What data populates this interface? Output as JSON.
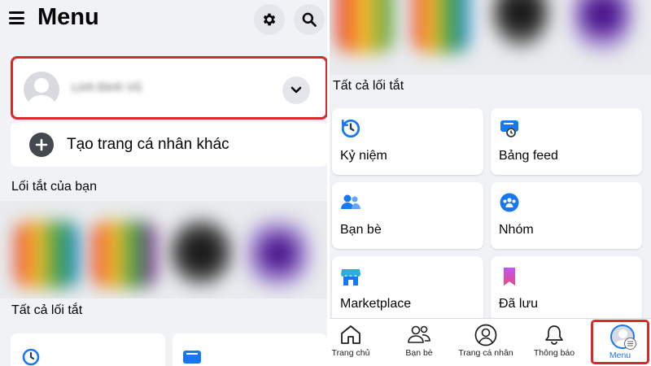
{
  "left": {
    "title": "Menu",
    "profile_name": "Linh Đinh Vũ",
    "create_profile_label": "Tạo trang cá nhân khác",
    "shortcuts_label": "Lối tắt của bạn",
    "all_shortcuts_label": "Tất cả lối tắt",
    "icons": {
      "menu": "hamburger-icon",
      "settings": "gear-icon",
      "search": "search-icon",
      "expand": "chevron-down-icon",
      "add": "plus-icon"
    }
  },
  "right": {
    "all_shortcuts_label": "Tất cả lối tắt",
    "shortcuts": [
      {
        "label": "Kỷ niệm",
        "icon": "memories-clock-icon",
        "color": "#1877f2"
      },
      {
        "label": "Bảng feed",
        "icon": "feed-icon",
        "color": "#1877f2"
      },
      {
        "label": "Bạn bè",
        "icon": "friends-icon",
        "color": "#1877f2"
      },
      {
        "label": "Nhóm",
        "icon": "groups-icon",
        "color": "#1877f2"
      },
      {
        "label": "Marketplace",
        "icon": "marketplace-shop-icon",
        "color": "#1877f2"
      },
      {
        "label": "Đã lưu",
        "icon": "saved-bookmark-icon",
        "color": "#a033ff"
      }
    ],
    "bottom_nav": [
      {
        "label": "Trang chủ",
        "icon": "home-icon",
        "active": false
      },
      {
        "label": "Bạn bè",
        "icon": "friends-icon",
        "active": false
      },
      {
        "label": "Trang cá nhân",
        "icon": "profile-icon",
        "active": false
      },
      {
        "label": "Thông báo",
        "icon": "bell-icon",
        "active": false
      },
      {
        "label": "Menu",
        "icon": "menu-avatar-icon",
        "active": true
      }
    ]
  },
  "colors": {
    "accent": "#1877f2",
    "highlight": "#d62a2a",
    "background": "#f0f2f5",
    "card": "#ffffff"
  }
}
